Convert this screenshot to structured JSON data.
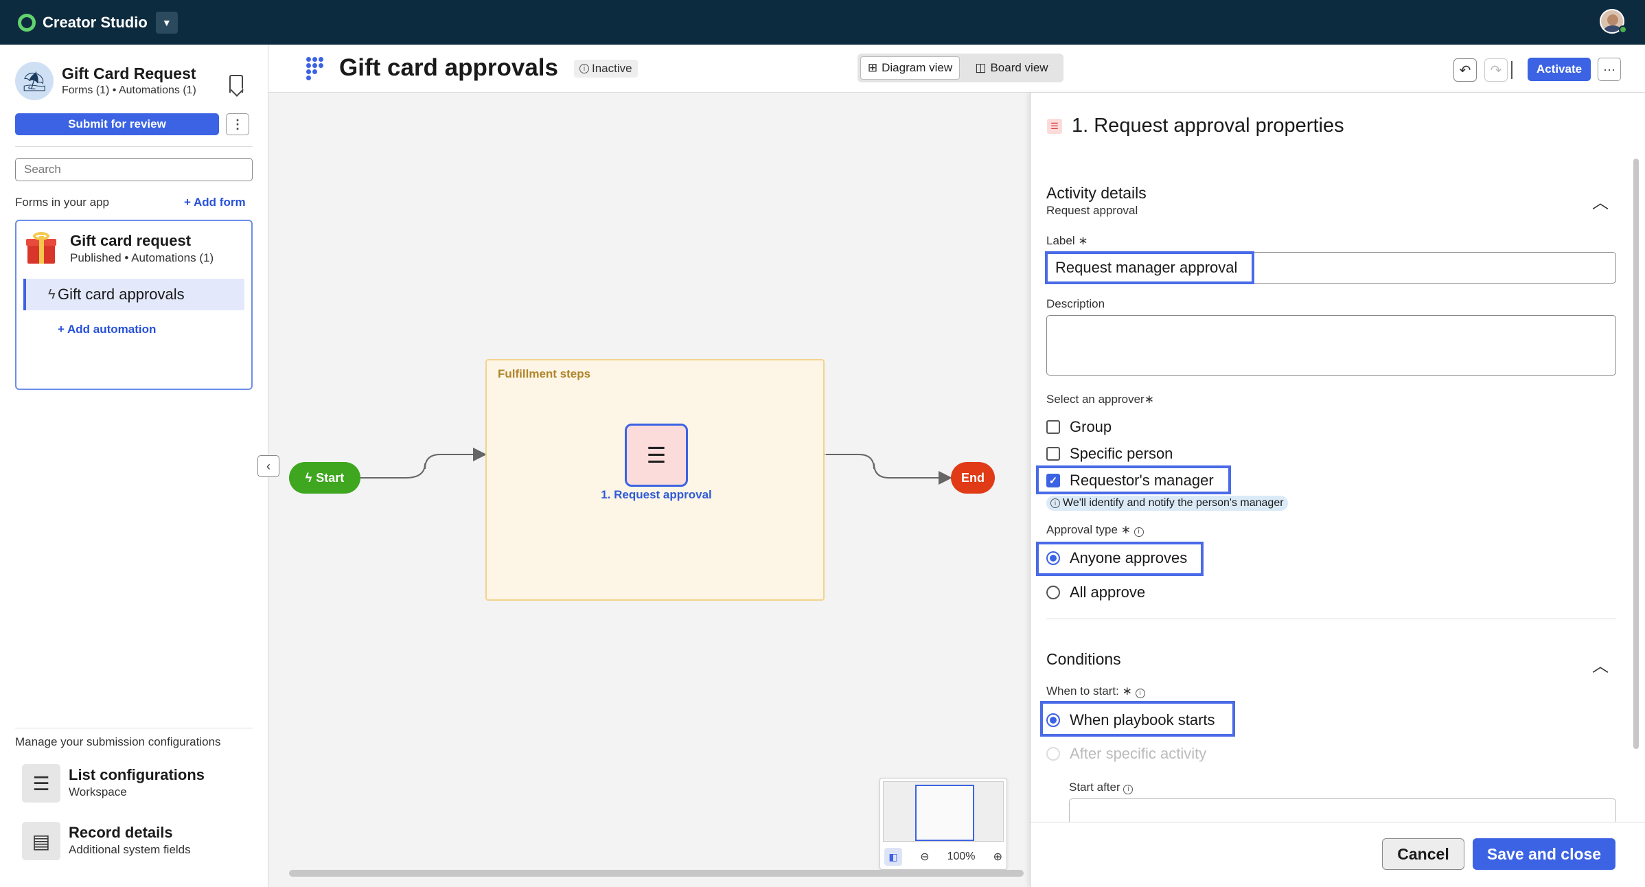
{
  "topbar": {
    "brand": "Creator Studio",
    "caret_icon": "chevron-down-icon",
    "avatar_icon": "user-avatar"
  },
  "sidebar": {
    "app_title": "Gift Card Request",
    "app_sub": "Forms (1) • Automations (1)",
    "submit_label": "Submit for review",
    "more_label": "⋮",
    "search_placeholder": "Search",
    "forms_label": "Forms in your app",
    "add_form_label": "+ Add form",
    "form_card": {
      "title": "Gift card request",
      "sub": "Published • Automations (1)",
      "automation_label": "Gift card approvals",
      "add_automation_label": "+ Add automation"
    },
    "manage_label": "Manage your submission configurations",
    "configs": [
      {
        "title": "List configurations",
        "sub": "Workspace",
        "icon": "list-icon"
      },
      {
        "title": "Record details",
        "sub": "Additional system fields",
        "icon": "record-icon"
      }
    ]
  },
  "header": {
    "title": "Gift card approvals",
    "status": "Inactive",
    "views": [
      "Diagram view",
      "Board view"
    ],
    "active_view": "Diagram view",
    "activate_label": "Activate",
    "more_label": "···"
  },
  "canvas": {
    "group_label": "Fulfillment steps",
    "start_label": "Start",
    "end_label": "End",
    "task_label": "1. Request approval",
    "zoom": "100%",
    "colors": {
      "start": "#3ea61f",
      "end": "#e03a16",
      "accent": "#3b63e3"
    }
  },
  "panel": {
    "title": "1. Request approval properties",
    "activity": {
      "title": "Activity details",
      "sub": "Request approval"
    },
    "label_field": {
      "label": "Label",
      "value": "Request manager approval"
    },
    "description_label": "Description",
    "approver": {
      "label": "Select an approver",
      "options": [
        {
          "label": "Group",
          "checked": false
        },
        {
          "label": "Specific person",
          "checked": false
        },
        {
          "label": "Requestor's manager",
          "checked": true
        }
      ],
      "hint": "We'll identify and notify the person's manager"
    },
    "approval_type": {
      "label": "Approval type",
      "options": [
        {
          "label": "Anyone approves",
          "selected": true
        },
        {
          "label": "All approve",
          "selected": false
        }
      ]
    },
    "conditions": {
      "title": "Conditions",
      "when_label": "When to start:",
      "options": [
        {
          "label": "When playbook starts",
          "selected": true
        },
        {
          "label": "After specific activity",
          "selected": false,
          "disabled": true
        }
      ],
      "start_after_label": "Start after"
    },
    "cancel_label": "Cancel",
    "save_label": "Save and close"
  }
}
